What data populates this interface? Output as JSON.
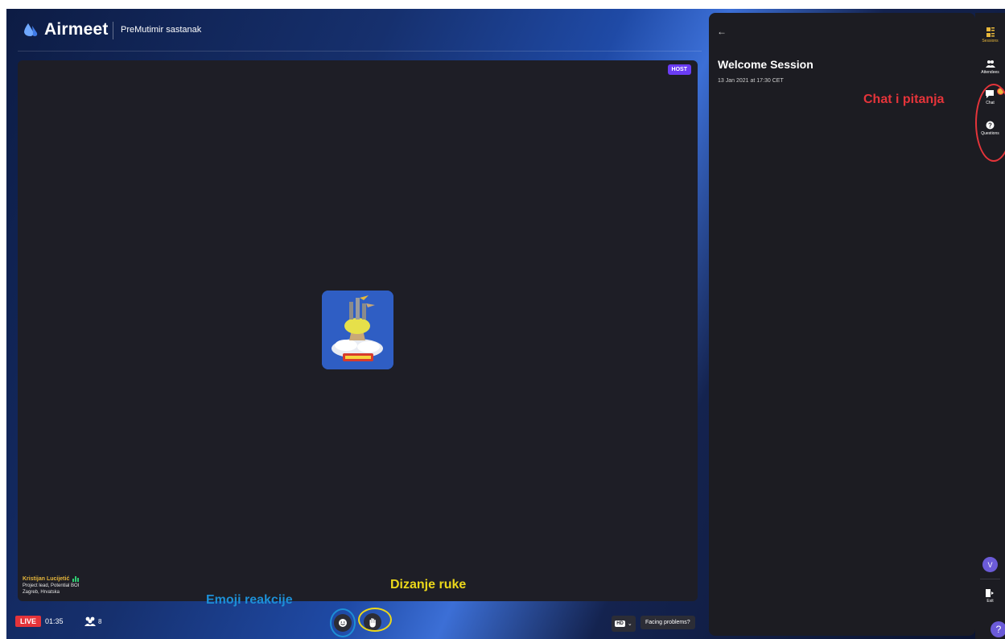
{
  "app": {
    "brand": "Airmeet",
    "event_title": "PreMutimir sastanak"
  },
  "stage": {
    "host_badge": "HOST",
    "speaker": {
      "name": "Kristijan Lucijetić",
      "role": "Project lead, Potential BOI",
      "location": "Zagreb, Hrvatska"
    }
  },
  "bottom_bar": {
    "live_label": "LIVE",
    "timer": "01:35",
    "attendee_count": "8",
    "hd_label": "HD",
    "facing_problems_label": "Facing problems?"
  },
  "session_panel": {
    "title": "Welcome Session",
    "date": "13 Jan 2021 at 17:30 CET"
  },
  "rail": {
    "items": [
      {
        "label": "Sessions",
        "icon": "sessions-icon",
        "active": true
      },
      {
        "label": "Attendees",
        "icon": "attendees-icon",
        "active": false
      },
      {
        "label": "Chat",
        "icon": "chat-icon",
        "active": false
      },
      {
        "label": "Questions",
        "icon": "questions-icon",
        "active": false
      }
    ],
    "user_initial": "V",
    "exit_label": "Exit",
    "help_glyph": "?"
  },
  "annotations": {
    "emoji": "Emoji reakcije",
    "raise_hand": "Dizanje ruke",
    "chat_questions": "Chat i pitanja"
  },
  "colors": {
    "live_red": "#e5343a",
    "host_purple": "#6b3cf5",
    "accent_yellow": "#e7b73b",
    "annotation_blue": "#1d8fd6",
    "annotation_yellow": "#ecd81a",
    "annotation_red": "#e5343a"
  }
}
